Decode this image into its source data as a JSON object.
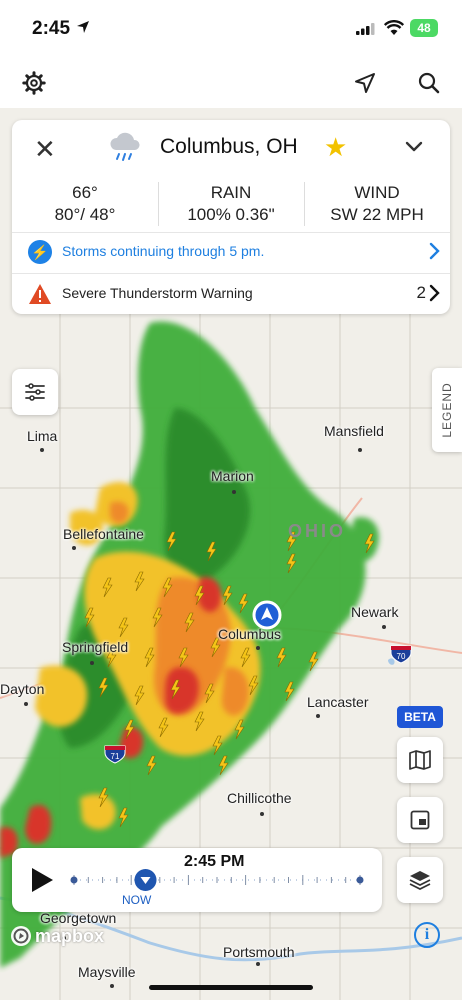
{
  "status_bar": {
    "time": "2:45",
    "battery": "48"
  },
  "toolbar": {
    "settings_icon": "gear-icon",
    "locate_icon": "location-arrow-icon",
    "search_icon": "search-icon"
  },
  "card": {
    "location": "Columbus, OH",
    "condition_icon": "rain-cloud-icon",
    "favorite_icon": "star-icon",
    "temp_current": "66°",
    "temp_range": "80°/ 48°",
    "rain_label": "RAIN",
    "rain_value": "100% 0.36\"",
    "wind_label": "WIND",
    "wind_value": "SW 22 MPH",
    "forecast_text": "Storms continuing through 5 pm.",
    "alert_text": "Severe Thunderstorm Warning",
    "alert_count": "2"
  },
  "map": {
    "state_label": "OHIO",
    "cities": {
      "lima": "Lima",
      "mansfield": "Mansfield",
      "marion": "Marion",
      "bellefontaine": "Bellefontaine",
      "newark": "Newark",
      "springfield": "Springfield",
      "columbus": "Columbus",
      "dayton": "Dayton",
      "lancaster": "Lancaster",
      "chillicothe": "Chillicothe",
      "georgetown": "Georgetown",
      "portsmouth": "Portsmouth",
      "maysville": "Maysville"
    },
    "highways": {
      "i70": "70",
      "i71": "71"
    },
    "legend_label": "LEGEND",
    "beta_label": "BETA",
    "attribution": "mapbox"
  },
  "timeline": {
    "time": "2:45 PM",
    "now_label": "NOW",
    "progress": 0.25
  },
  "colors": {
    "accent": "#1e7fe0",
    "radar_green": "#3fae3a",
    "radar_yellow": "#f2c22b",
    "radar_red": "#d8342a",
    "lightning": "#f5c518"
  }
}
